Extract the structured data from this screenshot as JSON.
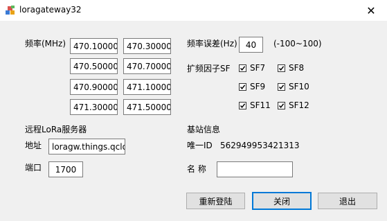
{
  "window": {
    "title": "loragateway32",
    "close_glyph": "✕"
  },
  "frequency": {
    "label": "频率(MHz)",
    "values": [
      "470.100000",
      "470.300000",
      "470.500000",
      "470.700000",
      "470.900000",
      "471.100000",
      "471.300000",
      "471.500000"
    ]
  },
  "freq_error": {
    "label": "频率误差(Hz)",
    "value": "40",
    "range": "(-100~100)"
  },
  "spreading_factor": {
    "label": "扩频因子SF",
    "options": [
      {
        "label": "SF7",
        "checked": true
      },
      {
        "label": "SF8",
        "checked": true
      },
      {
        "label": "SF9",
        "checked": true
      },
      {
        "label": "SF10",
        "checked": true
      },
      {
        "label": "SF11",
        "checked": true
      },
      {
        "label": "SF12",
        "checked": true
      }
    ]
  },
  "remote_server": {
    "section_title": "远程LoRa服务器",
    "address_label": "地址",
    "address_value": "loragw.things.qcloud",
    "port_label": "端口",
    "port_value": "1700"
  },
  "base_station": {
    "section_title": "基站信息",
    "id_label": "唯一ID",
    "id_value": "562949953421313",
    "name_label": "名 称",
    "name_value": ""
  },
  "buttons": {
    "relogin": "重新登陆",
    "close": "关闭",
    "exit": "退出"
  }
}
